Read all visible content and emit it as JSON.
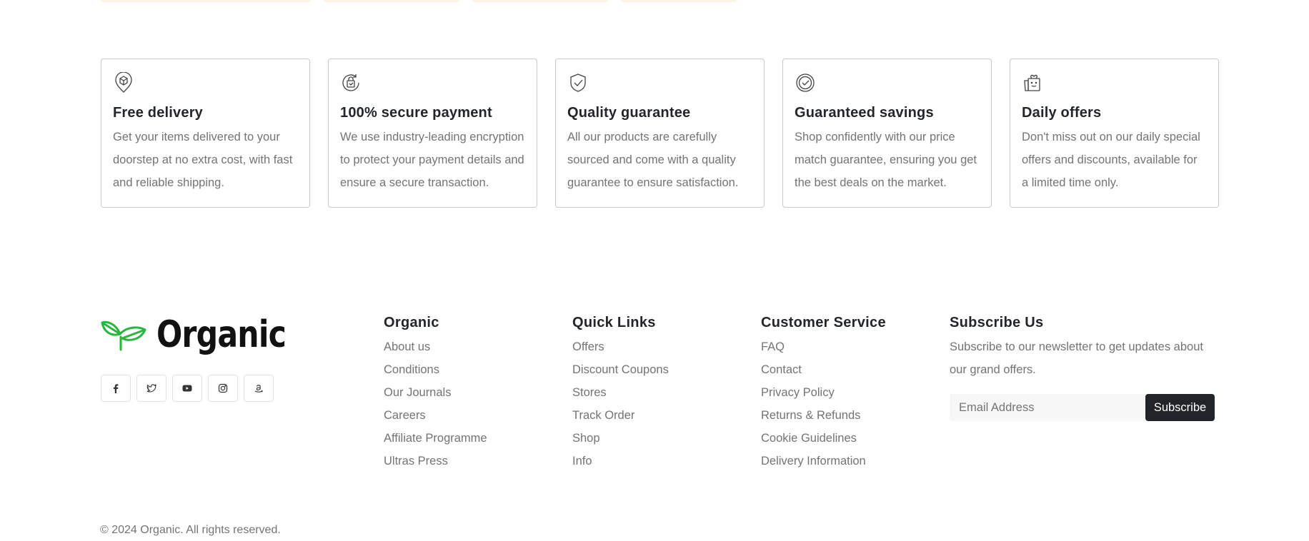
{
  "features": [
    {
      "icon": "package-pin-icon",
      "title": "Free delivery",
      "text": "Get your items delivered to your doorstep at no extra cost, with fast and reliable shipping."
    },
    {
      "icon": "secure-bag-icon",
      "title": "100% secure payment",
      "text": "We use industry-leading encryption to protect your payment details and ensure a secure transaction."
    },
    {
      "icon": "shield-check-icon",
      "title": "Quality guarantee",
      "text": "All our products are carefully sourced and come with a quality guarantee to ensure satisfaction."
    },
    {
      "icon": "check-circle-icon",
      "title": "Guaranteed savings",
      "text": "Shop confidently with our price match guarantee, ensuring you get the best deals on the market."
    },
    {
      "icon": "gift-icon",
      "title": "Daily offers",
      "text": "Don't miss out on our daily special offers and discounts, available for a limited time only."
    }
  ],
  "footer": {
    "brand": "Organic",
    "brand_color": "#2ab53f",
    "socials": [
      "facebook-icon",
      "twitter-icon",
      "youtube-icon",
      "instagram-icon",
      "amazon-icon"
    ],
    "columns": [
      {
        "title": "Organic",
        "links": [
          "About us",
          "Conditions",
          "Our Journals",
          "Careers",
          "Affiliate Programme",
          "Ultras Press"
        ]
      },
      {
        "title": "Quick Links",
        "links": [
          "Offers",
          "Discount Coupons",
          "Stores",
          "Track Order",
          "Shop",
          "Info"
        ]
      },
      {
        "title": "Customer Service",
        "links": [
          "FAQ",
          "Contact",
          "Privacy Policy",
          "Returns & Refunds",
          "Cookie Guidelines",
          "Delivery Information"
        ]
      }
    ],
    "subscribe": {
      "title": "Subscribe Us",
      "text": "Subscribe to our newsletter to get updates about our grand offers.",
      "placeholder": "Email Address",
      "button": "Subscribe"
    },
    "copyright": "© 2024 Organic. All rights reserved."
  }
}
